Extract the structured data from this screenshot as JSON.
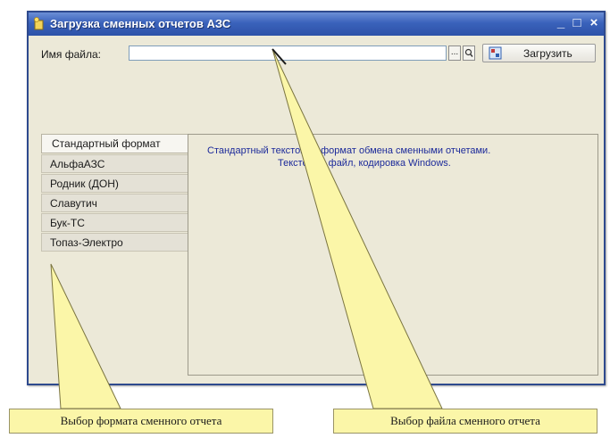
{
  "window": {
    "title": "Загрузка сменных отчетов АЗС",
    "minimize_label": "_",
    "maximize_label": "□",
    "close_label": "×"
  },
  "file_row": {
    "label": "Имя файла:",
    "value": "",
    "browse_label": "...",
    "search_label": "🔍",
    "load_button_label": "Загрузить"
  },
  "formats": {
    "selected": "Стандартный формат",
    "items": [
      {
        "label": "Стандартный формат"
      },
      {
        "label": "АльфаАЗС"
      },
      {
        "label": "Родник (ДОН)"
      },
      {
        "label": "Славутич"
      },
      {
        "label": "Бук-ТС"
      },
      {
        "label": "Топаз-Электро"
      }
    ],
    "description_line1": "Стандартный текстовый формат обмена сменными отчетами.",
    "description_line2": "Текстовый файл, кодировка Windows."
  },
  "callouts": {
    "format_choice": "Выбор формата сменного отчета",
    "file_choice": "Выбор файла сменного отчета"
  },
  "colors": {
    "titlebar": "#3a62bb",
    "window_bg": "#ece9d8",
    "description_text": "#1c2a9a",
    "callout_fill": "#fbf6a8"
  }
}
